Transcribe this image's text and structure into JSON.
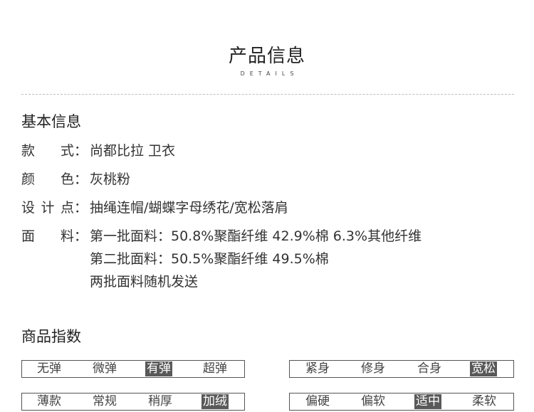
{
  "header": {
    "title": "产品信息",
    "subtitle": "DETAILS"
  },
  "basic_info": {
    "title": "基本信息",
    "style_label": [
      "款",
      "式"
    ],
    "style_value": "尚都比拉 卫衣",
    "color_label": [
      "颜",
      "色"
    ],
    "color_value": "灰桃粉",
    "design_label": [
      "设",
      "计",
      "点"
    ],
    "design_value": "抽绳连帽/蝴蝶字母绣花/宽松落肩",
    "fabric_label": [
      "面",
      "料"
    ],
    "fabric_lines": [
      "第一批面料：50.8%聚酯纤维 42.9%棉 6.3%其他纤维",
      "第二批面料：50.5%聚酯纤维 49.5%棉",
      "两批面料随机发送"
    ],
    "colon": "："
  },
  "indices": {
    "title": "商品指数",
    "elasticity": {
      "options": [
        "无弹",
        "微弹",
        "有弹",
        "超弹"
      ],
      "selected": "有弹"
    },
    "fit": {
      "options": [
        "紧身",
        "修身",
        "合身",
        "宽松"
      ],
      "selected": "宽松"
    },
    "thickness": {
      "options": [
        "薄款",
        "常规",
        "稍厚",
        "加绒"
      ],
      "selected": "加绒"
    },
    "softness": {
      "options": [
        "偏硬",
        "偏软",
        "适中",
        "柔软"
      ],
      "selected": "适中"
    }
  }
}
